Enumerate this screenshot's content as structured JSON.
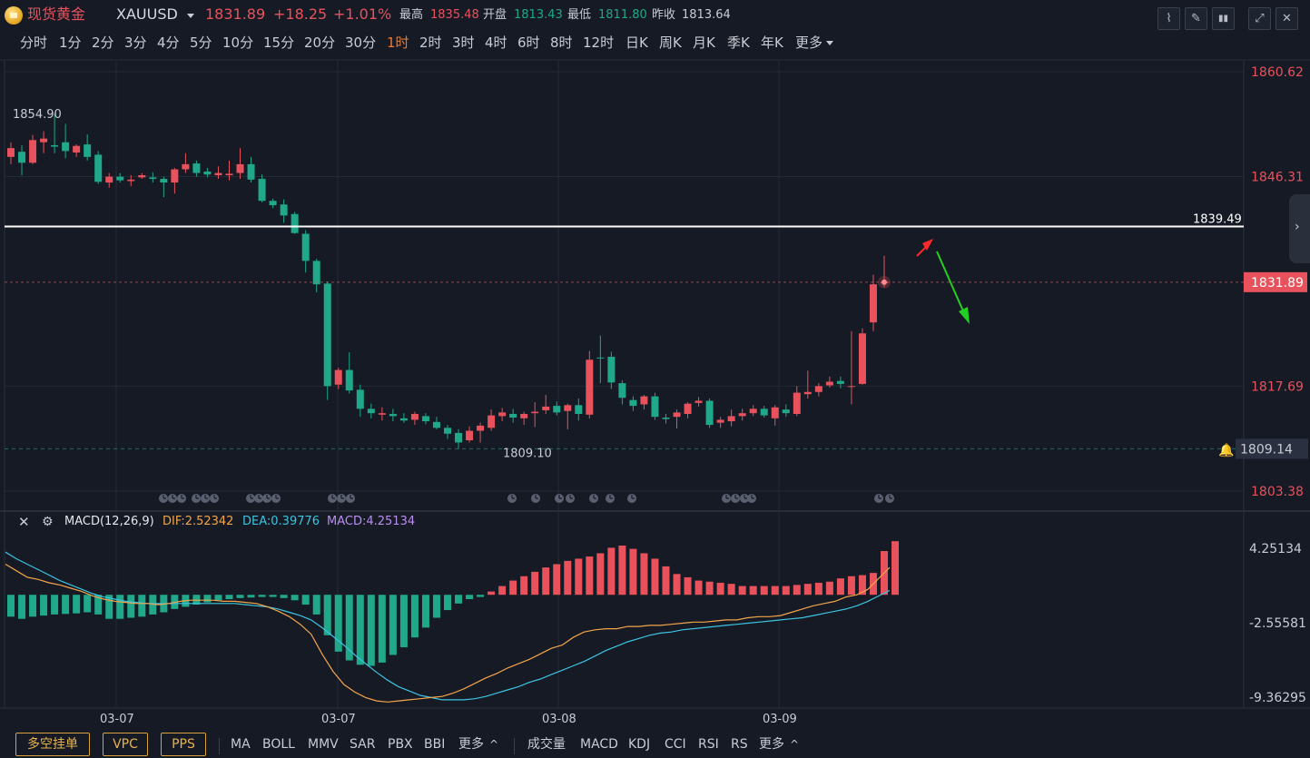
{
  "header": {
    "symbol_name": "现货黄金",
    "symbol_code": "XAUUSD",
    "price": "1831.89",
    "change": "+18.25",
    "change_pct": "+1.01%",
    "high_label": "最高",
    "high": "1835.48",
    "open_label": "开盘",
    "open": "1813.43",
    "low_label": "最低",
    "low": "1811.80",
    "prev_close_label": "昨收",
    "prev_close": "1813.64"
  },
  "toolbar": {
    "icons": [
      "line-chart-icon",
      "draw-pen-icon",
      "candles-icon",
      "fullscreen-icon",
      "close-icon"
    ],
    "glyphs": [
      "⌇",
      "✎",
      "▮▮",
      "⤢",
      "✕"
    ]
  },
  "periods": {
    "items": [
      "分时",
      "1分",
      "2分",
      "3分",
      "4分",
      "5分",
      "10分",
      "15分",
      "20分",
      "30分",
      "1时",
      "2时",
      "3时",
      "4时",
      "6时",
      "8时",
      "12时",
      "日K",
      "周K",
      "月K",
      "季K",
      "年K",
      "更多"
    ],
    "active": "1时"
  },
  "colors": {
    "up": "#e8525c",
    "down": "#1fa88a",
    "background": "#161a25",
    "grid": "#232937",
    "dif": "#f2a54a",
    "dea": "#3cc4e0",
    "macd_label": "#b98ef0"
  },
  "price_axis": {
    "ticks": [
      "1860.62",
      "1846.31",
      "1817.69",
      "1803.38"
    ],
    "horizontal_line": "1839.49",
    "last_price": "1831.89",
    "alert_level": "1809.14"
  },
  "annotations": {
    "max_label": "1854.90",
    "min_label": "1809.10"
  },
  "macd": {
    "title": "MACD(12,26,9)",
    "dif_label": "DIF:2.52342",
    "dea_label": "DEA:0.39776",
    "macd_label": "MACD:4.25134",
    "axis_ticks": [
      "4.25134",
      "-2.55581",
      "-9.36295"
    ]
  },
  "date_axis": [
    "03-07",
    "03-07",
    "03-08",
    "03-09"
  ],
  "bottom_bar": {
    "buttons": [
      "多空挂单",
      "VPC",
      "PPS"
    ],
    "main_indicators": [
      "MA",
      "BOLL",
      "MMV",
      "SAR",
      "PBX",
      "BBI"
    ],
    "sub_indicators": [
      "成交量",
      "MACD",
      "KDJ",
      "CCI",
      "RSI",
      "RS"
    ],
    "more": "更多"
  },
  "chart_data": {
    "type": "candlestick",
    "symbol": "XAUUSD",
    "interval": "1时",
    "y_range": [
      1801.5,
      1861.5
    ],
    "candles": [
      {
        "o": 1849.0,
        "h": 1851.0,
        "l": 1848.0,
        "c": 1850.2
      },
      {
        "o": 1849.7,
        "h": 1850.6,
        "l": 1846.5,
        "c": 1848.2
      },
      {
        "o": 1848.2,
        "h": 1852.0,
        "l": 1848.0,
        "c": 1851.3
      },
      {
        "o": 1851.0,
        "h": 1852.5,
        "l": 1849.5,
        "c": 1851.5
      },
      {
        "o": 1850.6,
        "h": 1854.9,
        "l": 1849.5,
        "c": 1850.4
      },
      {
        "o": 1851.0,
        "h": 1853.5,
        "l": 1848.8,
        "c": 1849.8
      },
      {
        "o": 1849.6,
        "h": 1850.7,
        "l": 1849.0,
        "c": 1850.5
      },
      {
        "o": 1850.7,
        "h": 1852.1,
        "l": 1848.5,
        "c": 1849.0
      },
      {
        "o": 1849.3,
        "h": 1849.8,
        "l": 1845.3,
        "c": 1845.6
      },
      {
        "o": 1845.5,
        "h": 1846.8,
        "l": 1844.8,
        "c": 1846.3
      },
      {
        "o": 1846.3,
        "h": 1846.8,
        "l": 1845.5,
        "c": 1845.8
      },
      {
        "o": 1845.7,
        "h": 1846.5,
        "l": 1845.0,
        "c": 1845.9
      },
      {
        "o": 1846.2,
        "h": 1846.8,
        "l": 1846.0,
        "c": 1846.5
      },
      {
        "o": 1846.2,
        "h": 1846.9,
        "l": 1845.5,
        "c": 1846.0
      },
      {
        "o": 1846.0,
        "h": 1846.3,
        "l": 1843.5,
        "c": 1845.5
      },
      {
        "o": 1845.5,
        "h": 1847.5,
        "l": 1844.0,
        "c": 1847.3
      },
      {
        "o": 1847.3,
        "h": 1849.5,
        "l": 1846.8,
        "c": 1848.0
      },
      {
        "o": 1848.1,
        "h": 1848.5,
        "l": 1846.3,
        "c": 1846.8
      },
      {
        "o": 1847.0,
        "h": 1847.5,
        "l": 1846.2,
        "c": 1846.6
      },
      {
        "o": 1846.5,
        "h": 1847.7,
        "l": 1846.0,
        "c": 1846.8
      },
      {
        "o": 1846.5,
        "h": 1848.5,
        "l": 1845.8,
        "c": 1846.7
      },
      {
        "o": 1846.8,
        "h": 1850.2,
        "l": 1846.0,
        "c": 1848.0
      },
      {
        "o": 1848.0,
        "h": 1849.0,
        "l": 1845.5,
        "c": 1845.9
      },
      {
        "o": 1846.0,
        "h": 1846.6,
        "l": 1842.8,
        "c": 1843.0
      },
      {
        "o": 1843.0,
        "h": 1843.3,
        "l": 1842.0,
        "c": 1842.4
      },
      {
        "o": 1842.5,
        "h": 1843.2,
        "l": 1840.0,
        "c": 1841.0
      },
      {
        "o": 1841.2,
        "h": 1841.5,
        "l": 1838.5,
        "c": 1838.6
      },
      {
        "o": 1838.5,
        "h": 1839.0,
        "l": 1833.2,
        "c": 1834.8
      },
      {
        "o": 1834.8,
        "h": 1835.1,
        "l": 1830.5,
        "c": 1831.6
      },
      {
        "o": 1831.7,
        "h": 1832.0,
        "l": 1815.8,
        "c": 1817.7
      },
      {
        "o": 1817.9,
        "h": 1820.2,
        "l": 1817.3,
        "c": 1819.9
      },
      {
        "o": 1819.9,
        "h": 1822.3,
        "l": 1816.7,
        "c": 1817.1
      },
      {
        "o": 1817.2,
        "h": 1817.9,
        "l": 1813.5,
        "c": 1814.6
      },
      {
        "o": 1814.6,
        "h": 1815.3,
        "l": 1813.3,
        "c": 1814.0
      },
      {
        "o": 1813.8,
        "h": 1814.8,
        "l": 1813.0,
        "c": 1814.0
      },
      {
        "o": 1813.9,
        "h": 1814.6,
        "l": 1812.9,
        "c": 1813.6
      },
      {
        "o": 1813.3,
        "h": 1814.0,
        "l": 1812.7,
        "c": 1813.0
      },
      {
        "o": 1813.1,
        "h": 1814.2,
        "l": 1812.4,
        "c": 1813.9
      },
      {
        "o": 1813.6,
        "h": 1814.0,
        "l": 1812.5,
        "c": 1812.9
      },
      {
        "o": 1812.8,
        "h": 1813.5,
        "l": 1811.8,
        "c": 1812.0
      },
      {
        "o": 1812.0,
        "h": 1812.4,
        "l": 1810.5,
        "c": 1811.2
      },
      {
        "o": 1811.3,
        "h": 1811.8,
        "l": 1809.1,
        "c": 1810.0
      },
      {
        "o": 1810.3,
        "h": 1812.2,
        "l": 1810.0,
        "c": 1811.6
      },
      {
        "o": 1811.6,
        "h": 1812.7,
        "l": 1810.0,
        "c": 1812.3
      },
      {
        "o": 1812.0,
        "h": 1814.5,
        "l": 1811.6,
        "c": 1813.7
      },
      {
        "o": 1813.6,
        "h": 1814.7,
        "l": 1812.9,
        "c": 1814.1
      },
      {
        "o": 1813.9,
        "h": 1814.6,
        "l": 1812.7,
        "c": 1813.4
      },
      {
        "o": 1813.3,
        "h": 1814.2,
        "l": 1812.4,
        "c": 1813.9
      },
      {
        "o": 1814.0,
        "h": 1815.5,
        "l": 1812.1,
        "c": 1814.2
      },
      {
        "o": 1814.4,
        "h": 1816.5,
        "l": 1813.9,
        "c": 1814.9
      },
      {
        "o": 1815.0,
        "h": 1815.6,
        "l": 1813.7,
        "c": 1814.1
      },
      {
        "o": 1814.3,
        "h": 1815.3,
        "l": 1811.8,
        "c": 1815.1
      },
      {
        "o": 1815.1,
        "h": 1816.0,
        "l": 1813.0,
        "c": 1813.9
      },
      {
        "o": 1813.8,
        "h": 1822.5,
        "l": 1813.3,
        "c": 1821.3
      },
      {
        "o": 1821.6,
        "h": 1824.6,
        "l": 1818.1,
        "c": 1821.5
      },
      {
        "o": 1821.7,
        "h": 1822.4,
        "l": 1817.3,
        "c": 1818.2
      },
      {
        "o": 1818.1,
        "h": 1818.5,
        "l": 1815.2,
        "c": 1816.1
      },
      {
        "o": 1815.8,
        "h": 1816.3,
        "l": 1814.3,
        "c": 1815.0
      },
      {
        "o": 1815.2,
        "h": 1816.5,
        "l": 1814.5,
        "c": 1816.3
      },
      {
        "o": 1816.3,
        "h": 1816.8,
        "l": 1813.1,
        "c": 1813.5
      },
      {
        "o": 1813.4,
        "h": 1813.9,
        "l": 1812.6,
        "c": 1813.2
      },
      {
        "o": 1813.5,
        "h": 1814.5,
        "l": 1811.9,
        "c": 1814.1
      },
      {
        "o": 1813.9,
        "h": 1815.5,
        "l": 1813.3,
        "c": 1815.3
      },
      {
        "o": 1815.4,
        "h": 1816.2,
        "l": 1814.9,
        "c": 1815.7
      },
      {
        "o": 1815.7,
        "h": 1816.0,
        "l": 1812.0,
        "c": 1812.4
      },
      {
        "o": 1812.7,
        "h": 1813.5,
        "l": 1812.0,
        "c": 1813.1
      },
      {
        "o": 1812.9,
        "h": 1814.5,
        "l": 1812.2,
        "c": 1813.6
      },
      {
        "o": 1813.6,
        "h": 1814.6,
        "l": 1813.0,
        "c": 1814.0
      },
      {
        "o": 1814.0,
        "h": 1815.1,
        "l": 1813.6,
        "c": 1814.6
      },
      {
        "o": 1814.6,
        "h": 1815.0,
        "l": 1813.4,
        "c": 1813.7
      },
      {
        "o": 1813.3,
        "h": 1815.1,
        "l": 1812.3,
        "c": 1814.8
      },
      {
        "o": 1814.5,
        "h": 1815.2,
        "l": 1813.5,
        "c": 1814.0
      },
      {
        "o": 1813.9,
        "h": 1817.7,
        "l": 1813.6,
        "c": 1816.8
      },
      {
        "o": 1816.6,
        "h": 1819.8,
        "l": 1816.0,
        "c": 1816.9
      },
      {
        "o": 1816.9,
        "h": 1818.1,
        "l": 1816.3,
        "c": 1817.7
      },
      {
        "o": 1817.8,
        "h": 1819.0,
        "l": 1817.5,
        "c": 1818.3
      },
      {
        "o": 1818.4,
        "h": 1819.0,
        "l": 1817.4,
        "c": 1818.0
      },
      {
        "o": 1817.7,
        "h": 1825.2,
        "l": 1815.2,
        "c": 1817.7
      },
      {
        "o": 1818.0,
        "h": 1825.6,
        "l": 1817.9,
        "c": 1824.9
      },
      {
        "o": 1826.4,
        "h": 1832.9,
        "l": 1825.2,
        "c": 1831.6
      },
      {
        "o": 1831.8,
        "h": 1835.5,
        "l": 1831.2,
        "c": 1831.9
      }
    ],
    "levels": {
      "horizontal_line": 1839.49,
      "last_price": 1831.89,
      "alert": 1809.14,
      "max": 1854.9,
      "min": 1809.1
    },
    "macd": {
      "params": "12,26,9",
      "dif": 2.52342,
      "dea": 0.39776,
      "macd": 4.25134,
      "y_range": [
        -10.4,
        6.6
      ],
      "histogram": [
        -2.0,
        -2.2,
        -2.0,
        -1.9,
        -1.8,
        -1.75,
        -1.7,
        -1.6,
        -1.8,
        -2.2,
        -2.2,
        -2.1,
        -2.0,
        -1.8,
        -1.6,
        -1.3,
        -1.1,
        -0.9,
        -0.7,
        -0.5,
        -0.4,
        -0.3,
        -0.25,
        -0.2,
        -0.2,
        -0.3,
        -0.5,
        -0.9,
        -1.8,
        -3.7,
        -5.2,
        -6.0,
        -6.4,
        -6.5,
        -6.2,
        -5.5,
        -4.8,
        -3.9,
        -3.0,
        -2.1,
        -1.4,
        -0.8,
        -0.4,
        -0.2,
        0.3,
        0.8,
        1.3,
        1.7,
        2.1,
        2.5,
        2.8,
        3.1,
        3.3,
        3.5,
        3.8,
        4.3,
        4.5,
        4.2,
        3.8,
        3.3,
        2.6,
        1.9,
        1.6,
        1.3,
        1.2,
        1.1,
        1.0,
        0.8,
        0.8,
        0.8,
        0.8,
        0.8,
        0.9,
        1.0,
        1.1,
        1.2,
        1.5,
        1.7,
        1.8,
        2.0,
        4.0,
        4.9
      ],
      "dif_values": [
        2.8,
        2.2,
        1.6,
        1.4,
        1.1,
        0.9,
        0.6,
        0.3,
        -0.1,
        -0.4,
        -0.6,
        -0.7,
        -0.8,
        -0.8,
        -0.9,
        -0.8,
        -0.6,
        -0.5,
        -0.5,
        -0.5,
        -0.6,
        -0.6,
        -0.7,
        -0.8,
        -1.1,
        -1.5,
        -2.0,
        -2.7,
        -3.6,
        -5.4,
        -7.0,
        -8.2,
        -8.9,
        -9.4,
        -9.7,
        -9.8,
        -9.7,
        -9.6,
        -9.5,
        -9.4,
        -9.3,
        -9.0,
        -8.6,
        -8.1,
        -7.6,
        -7.2,
        -6.7,
        -6.3,
        -5.9,
        -5.4,
        -4.9,
        -4.6,
        -3.9,
        -3.4,
        -3.2,
        -3.1,
        -3.1,
        -2.9,
        -2.9,
        -2.8,
        -2.8,
        -2.7,
        -2.6,
        -2.5,
        -2.5,
        -2.4,
        -2.3,
        -2.3,
        -2.1,
        -2.0,
        -2.0,
        -1.9,
        -1.6,
        -1.3,
        -1.0,
        -0.8,
        -0.6,
        -0.2,
        0.0,
        0.5,
        1.5,
        2.5
      ],
      "dea_values": [
        3.9,
        3.3,
        2.8,
        2.3,
        1.8,
        1.3,
        0.9,
        0.5,
        0.1,
        -0.2,
        -0.4,
        -0.6,
        -0.7,
        -0.8,
        -0.8,
        -0.8,
        -0.8,
        -0.8,
        -0.8,
        -0.8,
        -0.8,
        -0.8,
        -0.9,
        -1.0,
        -1.1,
        -1.3,
        -1.6,
        -1.9,
        -2.3,
        -3.0,
        -3.8,
        -4.6,
        -5.5,
        -6.3,
        -7.1,
        -7.8,
        -8.4,
        -8.8,
        -9.2,
        -9.4,
        -9.6,
        -9.6,
        -9.6,
        -9.5,
        -9.3,
        -9.0,
        -8.7,
        -8.4,
        -8.0,
        -7.7,
        -7.3,
        -6.9,
        -6.5,
        -6.1,
        -5.6,
        -5.1,
        -4.7,
        -4.3,
        -4.0,
        -3.7,
        -3.5,
        -3.4,
        -3.2,
        -3.1,
        -3.0,
        -2.9,
        -2.8,
        -2.7,
        -2.6,
        -2.5,
        -2.4,
        -2.3,
        -2.2,
        -2.1,
        -1.9,
        -1.7,
        -1.5,
        -1.3,
        -1.0,
        -0.6,
        -0.1,
        0.4
      ]
    }
  }
}
